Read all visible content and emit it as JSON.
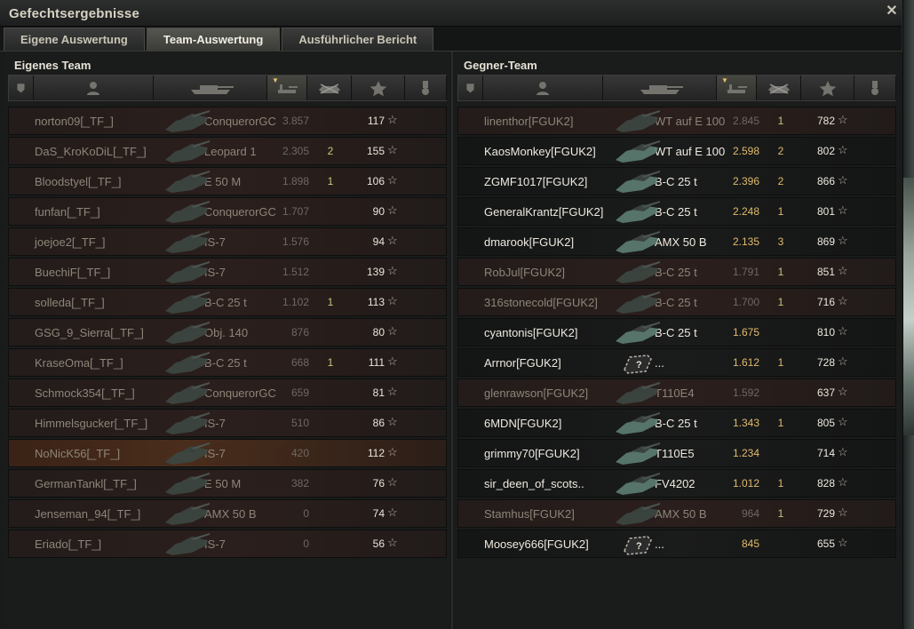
{
  "window": {
    "title": "Gefechtsergebnisse",
    "close_label": "✕"
  },
  "tabs": [
    {
      "label": "Eigene Auswertung",
      "active": false
    },
    {
      "label": "Team-Auswertung",
      "active": true
    },
    {
      "label": "Ausführlicher Bericht",
      "active": false
    }
  ],
  "own_team": {
    "title": "Eigenes Team",
    "rows": [
      {
        "name": "norton09[_TF_]",
        "vehicle": "ConquerorGC",
        "damage": "3.857",
        "kills": "",
        "xp": "117",
        "state": "dead"
      },
      {
        "name": "DaS_KroKoDiL[_TF_]",
        "vehicle": "Leopard 1",
        "damage": "2.305",
        "kills": "2",
        "xp": "155",
        "state": "dead"
      },
      {
        "name": "Bloodstyel[_TF_]",
        "vehicle": "E 50 M",
        "damage": "1.898",
        "kills": "1",
        "xp": "106",
        "state": "dead"
      },
      {
        "name": "funfan[_TF_]",
        "vehicle": "ConquerorGC",
        "damage": "1.707",
        "kills": "",
        "xp": "90",
        "state": "dead"
      },
      {
        "name": "joejoe2[_TF_]",
        "vehicle": "IS-7",
        "damage": "1.576",
        "kills": "",
        "xp": "94",
        "state": "dead"
      },
      {
        "name": "BuechiF[_TF_]",
        "vehicle": "IS-7",
        "damage": "1.512",
        "kills": "",
        "xp": "139",
        "state": "dead"
      },
      {
        "name": "solleda[_TF_]",
        "vehicle": "B-C 25 t",
        "damage": "1.102",
        "kills": "1",
        "xp": "113",
        "state": "dead"
      },
      {
        "name": "GSG_9_Sierra[_TF_]",
        "vehicle": "Obj. 140",
        "damage": "876",
        "kills": "",
        "xp": "80",
        "state": "dead"
      },
      {
        "name": "KraseOma[_TF_]",
        "vehicle": "B-C 25 t",
        "damage": "668",
        "kills": "1",
        "xp": "111",
        "state": "dead"
      },
      {
        "name": "Schmock354[_TF_]",
        "vehicle": "ConquerorGC",
        "damage": "659",
        "kills": "",
        "xp": "81",
        "state": "dead"
      },
      {
        "name": "Himmelsgucker[_TF_]",
        "vehicle": "IS-7",
        "damage": "510",
        "kills": "",
        "xp": "86",
        "state": "dead"
      },
      {
        "name": "NoNicK56[_TF_]",
        "vehicle": "IS-7",
        "damage": "420",
        "kills": "",
        "xp": "112",
        "state": "self"
      },
      {
        "name": "GermanTankl[_TF_]",
        "vehicle": "E 50 M",
        "damage": "382",
        "kills": "",
        "xp": "76",
        "state": "dead"
      },
      {
        "name": "Jenseman_94[_TF_]",
        "vehicle": "AMX 50 B",
        "damage": "0",
        "kills": "",
        "xp": "74",
        "state": "dead"
      },
      {
        "name": "Eriado[_TF_]",
        "vehicle": "IS-7",
        "damage": "0",
        "kills": "",
        "xp": "56",
        "state": "dead"
      }
    ]
  },
  "enemy_team": {
    "title": "Gegner-Team",
    "rows": [
      {
        "name": "linenthor[FGUK2]",
        "vehicle": "WT auf E 100",
        "damage": "2.845",
        "kills": "1",
        "xp": "782",
        "state": "dead"
      },
      {
        "name": "KaosMonkey[FGUK2]",
        "vehicle": "WT auf E 100",
        "damage": "2.598",
        "kills": "2",
        "xp": "802",
        "state": "alive"
      },
      {
        "name": "ZGMF1017[FGUK2]",
        "vehicle": "B-C 25 t",
        "damage": "2.396",
        "kills": "2",
        "xp": "866",
        "state": "alive"
      },
      {
        "name": "GeneralKrantz[FGUK2]",
        "vehicle": "B-C 25 t",
        "damage": "2.248",
        "kills": "1",
        "xp": "801",
        "state": "alive"
      },
      {
        "name": "dmarook[FGUK2]",
        "vehicle": "AMX 50 B",
        "damage": "2.135",
        "kills": "3",
        "xp": "869",
        "state": "alive"
      },
      {
        "name": "RobJul[FGUK2]",
        "vehicle": "B-C 25 t",
        "damage": "1.791",
        "kills": "1",
        "xp": "851",
        "state": "dead"
      },
      {
        "name": "316stonecold[FGUK2]",
        "vehicle": "B-C 25 t",
        "damage": "1.700",
        "kills": "1",
        "xp": "716",
        "state": "dead"
      },
      {
        "name": "cyantonis[FGUK2]",
        "vehicle": "B-C 25 t",
        "damage": "1.675",
        "kills": "",
        "xp": "810",
        "state": "alive"
      },
      {
        "name": "Arrnor[FGUK2]",
        "vehicle": "...",
        "damage": "1.612",
        "kills": "1",
        "xp": "728",
        "state": "alive",
        "unknown": true
      },
      {
        "name": "glenrawson[FGUK2]",
        "vehicle": "T110E4",
        "damage": "1.592",
        "kills": "",
        "xp": "637",
        "state": "dead"
      },
      {
        "name": "6MDN[FGUK2]",
        "vehicle": "B-C 25 t",
        "damage": "1.343",
        "kills": "1",
        "xp": "805",
        "state": "alive"
      },
      {
        "name": "grimmy70[FGUK2]",
        "vehicle": "T110E5",
        "damage": "1.234",
        "kills": "",
        "xp": "714",
        "state": "alive"
      },
      {
        "name": "sir_deen_of_scots..",
        "vehicle": "FV4202",
        "damage": "1.012",
        "kills": "1",
        "xp": "828",
        "state": "alive"
      },
      {
        "name": "Stamhus[FGUK2]",
        "vehicle": "AMX 50 B",
        "damage": "964",
        "kills": "1",
        "xp": "729",
        "state": "dead"
      },
      {
        "name": "Moosey666[FGUK2]",
        "vehicle": "...",
        "damage": "845",
        "kills": "",
        "xp": "655",
        "state": "alive",
        "unknown": true
      }
    ]
  },
  "icons": {
    "squad": "chevron-badge-icon",
    "player": "user-icon",
    "tank": "tank-icon",
    "damage": "damage-icon",
    "kills": "kills-icon",
    "xp": "star-icon",
    "medal": "medal-icon"
  },
  "star_glyph": "☆",
  "colors": {
    "alive_name": "#eeeae0",
    "value_gold": "#e1bb6c",
    "dead_name": "#8d8578",
    "self_row": "#4a2d1c"
  }
}
